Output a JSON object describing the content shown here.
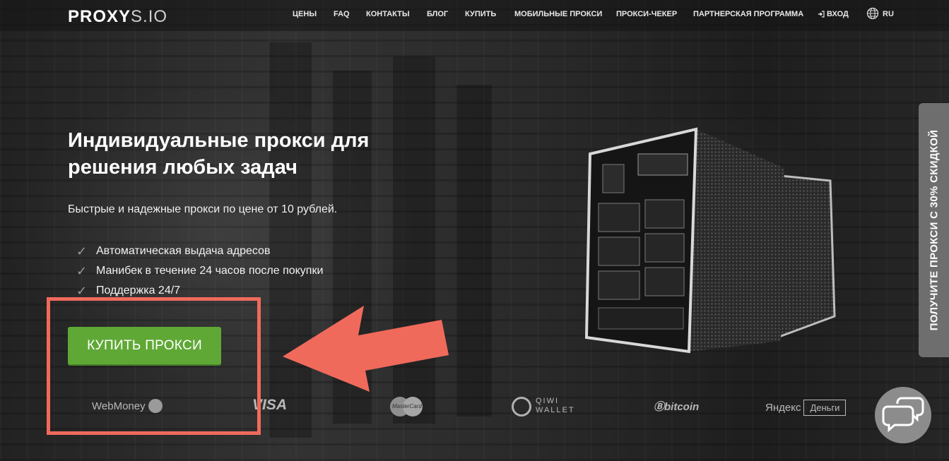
{
  "header": {
    "logo_bold": "PROXY",
    "logo_thin": "S.IO",
    "nav": [
      {
        "label": "ЦЕНЫ"
      },
      {
        "label": "FAQ"
      },
      {
        "label": "КОНТАКТЫ"
      },
      {
        "label": "БЛОГ"
      },
      {
        "label": "КУПИТЬ"
      },
      {
        "label": "МОБИЛЬНЫЕ ПРОКСИ"
      },
      {
        "label": "ПРОКСИ-ЧЕКЕР"
      },
      {
        "label": "ПАРТНЕРСКАЯ ПРОГРАММА"
      },
      {
        "label": "ВХОД"
      },
      {
        "label": "RU"
      }
    ]
  },
  "hero": {
    "title": "Индивидуальные прокси для решения любых задач",
    "subtitle": "Быстрые и надежные прокси по цене от 10 рублей.",
    "features": [
      "Автоматическая выдача адресов",
      "Манибек в течение 24 часов после покупки",
      "Поддержка 24/7"
    ],
    "buy_button": "КУПИТЬ ПРОКСИ"
  },
  "payments": {
    "webmoney": "WebMoney",
    "visa": "VISA",
    "mastercard": "MasterCard",
    "qiwi_line1": "QIWI",
    "qiwi_line2": "WALLET",
    "bitcoin": "bitcoin",
    "yandex": "Яндекс",
    "yandex_money": "Деньги"
  },
  "side_tab": {
    "label": "ПОЛУЧИТЕ ПРОКСИ С 30% СКИДКОЙ"
  },
  "colors": {
    "accent_green": "#5fa836",
    "annotation_red": "#f06a5c",
    "side_tab_bg": "#6e6e6e"
  },
  "icons": [
    "login-icon",
    "globe-icon",
    "check-icon",
    "chat-icon",
    "arrow-annotation-icon"
  ]
}
